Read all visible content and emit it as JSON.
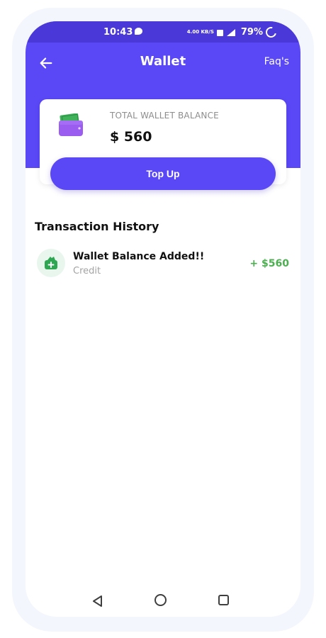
{
  "status_bar": {
    "time": "10:43",
    "net_speed": "4.00 KB/S",
    "battery": "79%"
  },
  "app_bar": {
    "title": "Wallet",
    "faq_label": "Faq's",
    "back_icon": "arrow-left-icon"
  },
  "balance_card": {
    "label": "TOTAL WALLET BALANCE",
    "amount": "$ 560",
    "icon": "wallet-icon"
  },
  "topup": {
    "label": "Top Up"
  },
  "transactions": {
    "title": "Transaction History",
    "items": [
      {
        "title": "Wallet Balance Added!!",
        "type": "Credit",
        "amount": "+ $560",
        "icon": "wallet-add-icon"
      }
    ]
  },
  "colors": {
    "primary": "#5a47f6",
    "credit": "#4caf50"
  }
}
